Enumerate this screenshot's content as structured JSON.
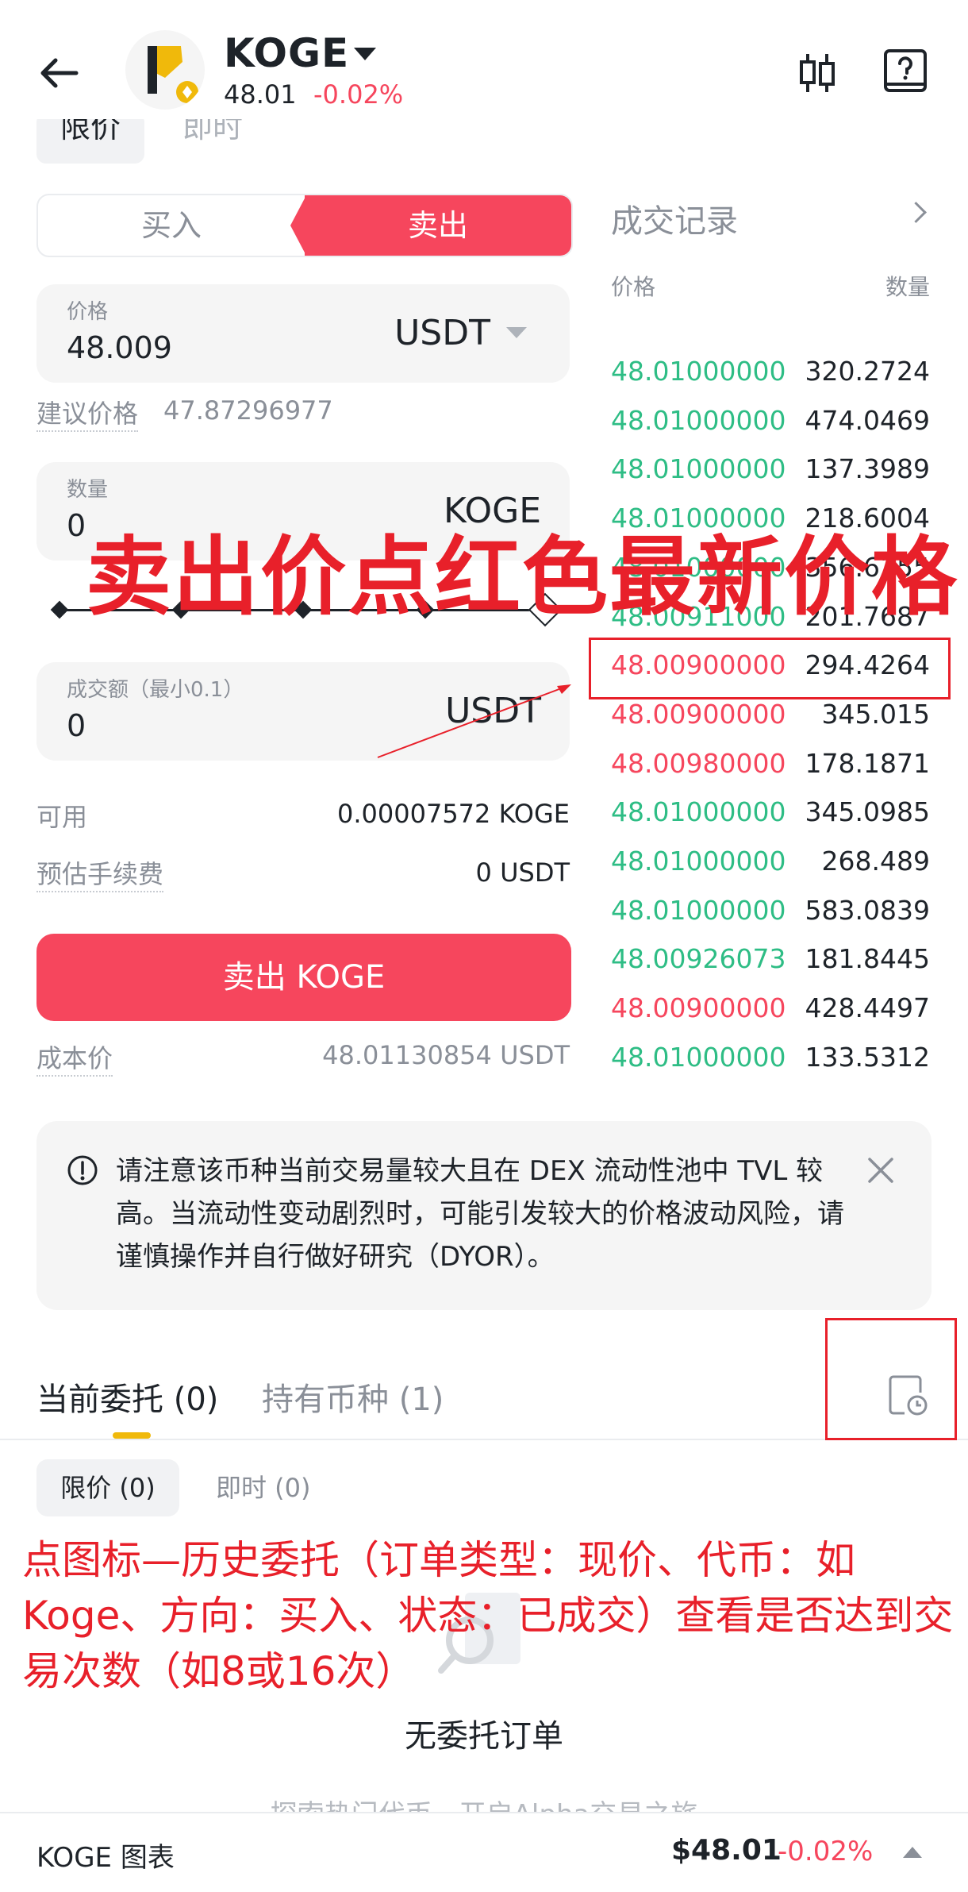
{
  "header": {
    "token": "KOGE",
    "price": "48.01",
    "change": "-0.02%"
  },
  "order_types": [
    "限价",
    "即时"
  ],
  "side_tabs": {
    "buy": "买入",
    "sell": "卖出"
  },
  "price_field": {
    "label": "价格",
    "value": "48.009",
    "unit": "USDT"
  },
  "suggested": {
    "label": "建议价格",
    "value": "47.87296977"
  },
  "qty_field": {
    "label": "数量",
    "value": "0",
    "unit": "KOGE"
  },
  "amount_field": {
    "label": "成交额（最小0.1）",
    "value": "0",
    "unit": "USDT"
  },
  "available": {
    "label": "可用",
    "value": "0.00007572 KOGE"
  },
  "fee": {
    "label": "预估手续费",
    "value": "0 USDT"
  },
  "sell_button": "卖出 KOGE",
  "cost": {
    "label": "成本价",
    "value": "48.01130854 USDT"
  },
  "trades": {
    "title": "成交记录",
    "col_price": "价格",
    "col_qty": "数量",
    "rows": [
      {
        "price": "48.01000000",
        "qty": "320.2724",
        "side": "buy"
      },
      {
        "price": "48.01000000",
        "qty": "474.0469",
        "side": "buy"
      },
      {
        "price": "48.01000000",
        "qty": "137.3989",
        "side": "buy"
      },
      {
        "price": "48.01000000",
        "qty": "218.6004",
        "side": "buy"
      },
      {
        "price": "48.01000000",
        "qty": "356.6155",
        "side": "buy"
      },
      {
        "price": "48.00911000",
        "qty": "201.7687",
        "side": "buy"
      },
      {
        "price": "48.00900000",
        "qty": "294.4264",
        "side": "sell"
      },
      {
        "price": "48.00900000",
        "qty": "345.015",
        "side": "sell"
      },
      {
        "price": "48.00980000",
        "qty": "178.1871",
        "side": "sell"
      },
      {
        "price": "48.01000000",
        "qty": "345.0985",
        "side": "buy"
      },
      {
        "price": "48.01000000",
        "qty": "268.489",
        "side": "buy"
      },
      {
        "price": "48.01000000",
        "qty": "583.0839",
        "side": "buy"
      },
      {
        "price": "48.00926073",
        "qty": "181.8445",
        "side": "buy"
      },
      {
        "price": "48.00900000",
        "qty": "428.4497",
        "side": "sell"
      },
      {
        "price": "48.01000000",
        "qty": "133.5312",
        "side": "buy"
      }
    ]
  },
  "notice": "请注意该币种当前交易量较大且在 DEX 流动性池中 TVL 较高。当流动性变动剧烈时，可能引发较大的价格波动风险，请谨慎操作并自行做好研究（DYOR）。",
  "bottom_tabs": {
    "current": "当前委托 (0)",
    "holdings": "持有币种 (1)"
  },
  "sub_tabs": {
    "limit": "限价 (0)",
    "instant": "即时 (0)"
  },
  "empty_text": "无委托订单",
  "explore_text": "探索热门代币，开启Alpha交易之旅",
  "bottom_bar": {
    "name": "KOGE 图表",
    "price": "$48.01",
    "change": "-0.02%"
  },
  "annotations": {
    "big": "卖出价点红色最新价格",
    "small": "点图标—历史委托（订单类型：现价、代币：如Koge、方向：买入、状态：已成交）查看是否达到交易次数（如8或16次）"
  },
  "colors": {
    "buy": "#2ebd85",
    "sell": "#f6465d",
    "accent": "#f0b90b",
    "annotation": "#e8202a"
  }
}
